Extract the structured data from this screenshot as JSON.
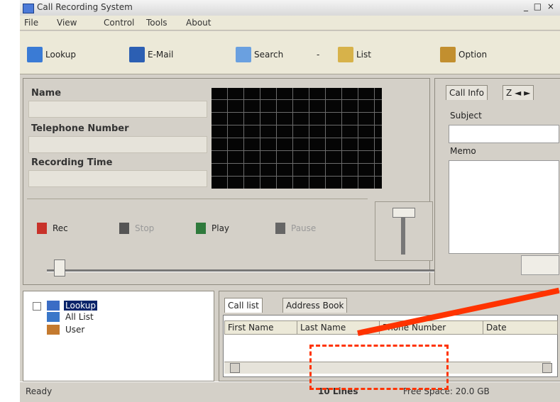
{
  "window": {
    "title": "Call Recording System",
    "controls": "_ □ ×"
  },
  "menu": [
    "File",
    "View",
    "Control",
    "Tools",
    "About"
  ],
  "toolbar": [
    {
      "label": "Lookup",
      "icon": "lookup-icon",
      "color": "#3a7bd5"
    },
    {
      "label": "E-Mail",
      "icon": "email-icon",
      "color": "#2c5fb3"
    },
    {
      "label": "Search",
      "icon": "search-icon",
      "color": "#6aa0e0"
    },
    {
      "label": "List",
      "icon": "list-icon",
      "color": "#d7b24a"
    },
    {
      "label": "Option",
      "icon": "option-icon",
      "color": "#c28f2f"
    }
  ],
  "info": {
    "name_label": "Name",
    "phone_label": "Telephone Number",
    "rectime_label": "Recording Time"
  },
  "controls": [
    {
      "label": "Rec",
      "icon": "record-icon"
    },
    {
      "label": "Stop",
      "icon": "stop-icon"
    },
    {
      "label": "Play",
      "icon": "play-icon"
    },
    {
      "label": "Pause",
      "icon": "pause-icon"
    }
  ],
  "callinfo": {
    "tab": "Call Info",
    "tab_nav": "Z ◄ ►",
    "subject_label": "Subject",
    "memo_label": "Memo"
  },
  "tree": {
    "items": [
      "Lookup",
      "All List",
      "User"
    ]
  },
  "listtabs": [
    "Call list",
    "Address Book"
  ],
  "columns": [
    "First Name",
    "Last Name",
    "Phone Number",
    "Date"
  ],
  "status": {
    "ready": "Ready",
    "left": "10 Lines",
    "right": "Free Space: 20.0 GB"
  }
}
